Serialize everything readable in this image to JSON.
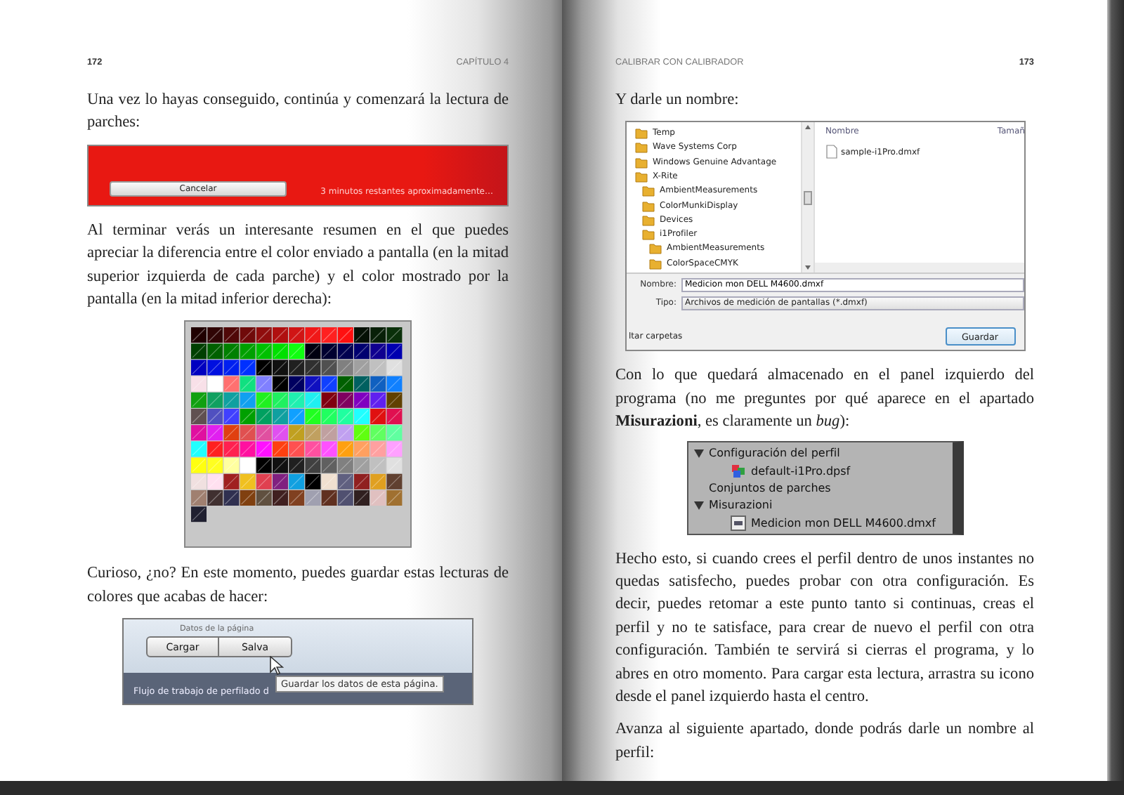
{
  "left_page": {
    "page_number": "172",
    "running_head": "CAPÍTULO 4",
    "blocks": [
      {
        "kind": "paragraph",
        "text": "Una vez lo hayas conseguido, continúa y comenzará la lectura de parches:"
      },
      {
        "kind": "progress_screenshot",
        "button": "Cancelar",
        "status": "3 minutos restantes aproximadamente…"
      },
      {
        "kind": "paragraph",
        "text": "Al terminar verás un interesante resumen en el que puedes apreciar la diferencia entre el color enviado a pantalla (en la mitad superior izquierda de cada parche) y el color mostrado por la pantalla (en la mitad inferior derecha):"
      },
      {
        "kind": "patch_grid"
      },
      {
        "kind": "paragraph",
        "text": "Curioso, ¿no? En este momento, puedes guardar estas lecturas de colores que acabas de hacer:"
      },
      {
        "kind": "save_panel",
        "group_label": "Datos de la página",
        "buttons": [
          "Cargar",
          "Salva"
        ],
        "tooltip": "Guardar los datos de esta página.",
        "workflow_label": "Flujo de trabajo de perfilado d"
      }
    ]
  },
  "right_page": {
    "running_head": "CALIBRAR CON CALIBRADOR",
    "page_number": "173",
    "blocks": [
      {
        "kind": "paragraph",
        "text": "Y darle un nombre:"
      },
      {
        "kind": "save_dialog",
        "folders": [
          {
            "label": "Temp"
          },
          {
            "label": "Wave Systems Corp"
          },
          {
            "label": "Windows Genuine Advantage"
          },
          {
            "label": "X-Rite",
            "children": [
              {
                "label": "AmbientMeasurements"
              },
              {
                "label": "ColorMunkiDisplay"
              },
              {
                "label": "Devices"
              },
              {
                "label": "i1Profiler",
                "children": [
                  {
                    "label": "AmbientMeasurements"
                  },
                  {
                    "label": "ColorSpaceCMYK"
                  }
                ]
              }
            ]
          }
        ],
        "file_columns": [
          "Nombre",
          "Tamañ"
        ],
        "files": [
          "sample-i1Pro.dmxf"
        ],
        "name_label": "Nombre:",
        "name_value": "Medicion mon DELL M4600.dmxf",
        "type_label": "Tipo:",
        "type_value": "Archivos de medición de pantallas (*.dmxf)",
        "hide_folders": "ltar carpetas",
        "save_button": "Guardar"
      },
      {
        "kind": "paragraph",
        "text": "Con lo que quedará almacenado en el panel izquierdo del programa (no me preguntes por qué aparece en el apartado **Misurazioni**, es claramente un *bug*):"
      },
      {
        "kind": "tree_panel",
        "items": [
          {
            "label": "Configuración del perfil",
            "expanded": true,
            "children": [
              {
                "label": "default-i1Pro.dpsf",
                "kind": "profile"
              }
            ]
          },
          {
            "label": "Conjuntos de parches"
          },
          {
            "label": "Misurazioni",
            "expanded": true,
            "children": [
              {
                "label": "Medicion mon DELL M4600.dmxf",
                "kind": "measurement"
              }
            ]
          }
        ]
      },
      {
        "kind": "paragraph",
        "text": "Hecho esto, si cuando crees el perfil dentro de unos instantes no quedas satisfecho, puedes probar con otra configuración. Es decir, puedes retomar a este punto tanto si continuas, creas el perfil y no te satisface, para crear de nuevo el perfil con otra configuración. También te servirá si cierras el programa, y lo abres en otro momento. Para cargar esta lectura, arrastra su icono desde el panel izquierdo hasta el centro."
      },
      {
        "kind": "paragraph",
        "text": "Avanza al siguiente apartado, donde podrás darle un nombre al perfil:"
      }
    ]
  }
}
